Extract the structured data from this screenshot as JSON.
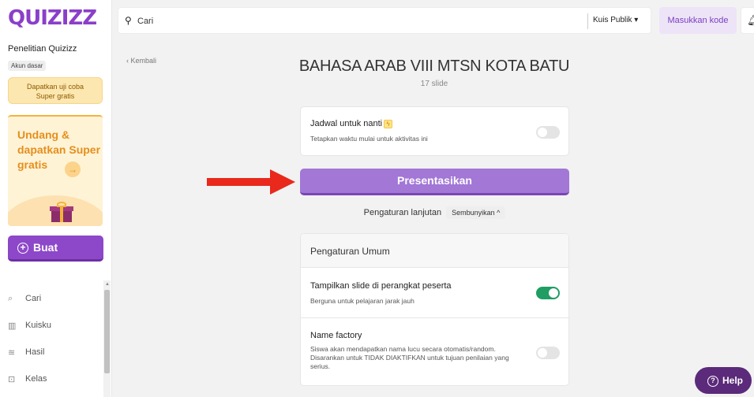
{
  "brand": {
    "logo_text": "QUIZIZZ",
    "color": "#8b3fc9"
  },
  "sidebar": {
    "user_name": "Penelitian Quizizz",
    "account_type": "Akun dasar",
    "trial_line1": "Dapatkan uji coba",
    "trial_line2": "Super gratis",
    "invite_text": "Undang & dapatkan Super gratis",
    "invite_arrow": "→",
    "create_label": "Buat",
    "items": [
      {
        "label": "Cari",
        "icon": "search-icon",
        "glyph": "⌕"
      },
      {
        "label": "Kuisku",
        "icon": "library-icon",
        "glyph": "▥"
      },
      {
        "label": "Hasil",
        "icon": "chart-icon",
        "glyph": "≊"
      },
      {
        "label": "Kelas",
        "icon": "class-icon",
        "glyph": "⊡"
      }
    ]
  },
  "topbar": {
    "search_placeholder": "Cari",
    "public_filter": "Kuis Publik ▾",
    "enter_code": "Masukkan kode"
  },
  "main": {
    "back_label": "‹ Kembali",
    "title": "BAHASA ARAB VIII MTSN KOTA BATU",
    "slide_count": "17 slide",
    "schedule": {
      "title": "Jadwal untuk nanti",
      "description": "Tetapkan waktu mulai untuk aktivitas ini",
      "enabled": false
    },
    "present_label": "Presentasikan",
    "advanced_label": "Pengaturan lanjutan",
    "hide_label": "Sembunyikan ^",
    "general": {
      "title": "Pengaturan Umum",
      "settings": [
        {
          "title": "Tampilkan slide di perangkat peserta",
          "description": "Berguna untuk pelajaran jarak jauh",
          "enabled": true
        },
        {
          "title": "Name factory",
          "description": "Siswa akan mendapatkan nama lucu secara otomatis/random. Disarankan untuk TIDAK DIAKTIFKAN untuk tujuan penilaian yang serius.",
          "enabled": false
        }
      ]
    }
  },
  "help_label": "Help",
  "colors": {
    "primary": "#8d47c9",
    "present": "#a277d6",
    "toggle_on": "#1f9d63",
    "arrow": "#e8291c",
    "help": "#5b2a7a"
  }
}
